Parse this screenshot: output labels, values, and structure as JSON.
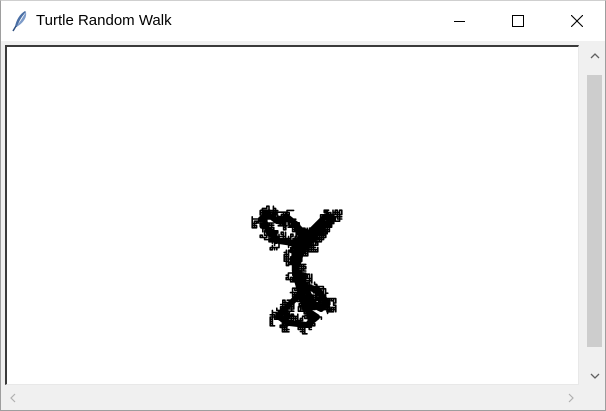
{
  "window": {
    "title": "Turtle Random Walk",
    "icon": "feather-icon",
    "controls": [
      "minimize-icon",
      "maximize-icon",
      "close-icon"
    ]
  },
  "canvas": {
    "background": "#ffffff",
    "pen_color": "#000000"
  },
  "scrollbars": {
    "vertical": {
      "icons": [
        "chevron-up-icon",
        "chevron-down-icon"
      ],
      "thumb_color": "#cdcdcd"
    },
    "horizontal": {
      "icons": [
        "chevron-left-icon",
        "chevron-right-icon"
      ]
    }
  }
}
